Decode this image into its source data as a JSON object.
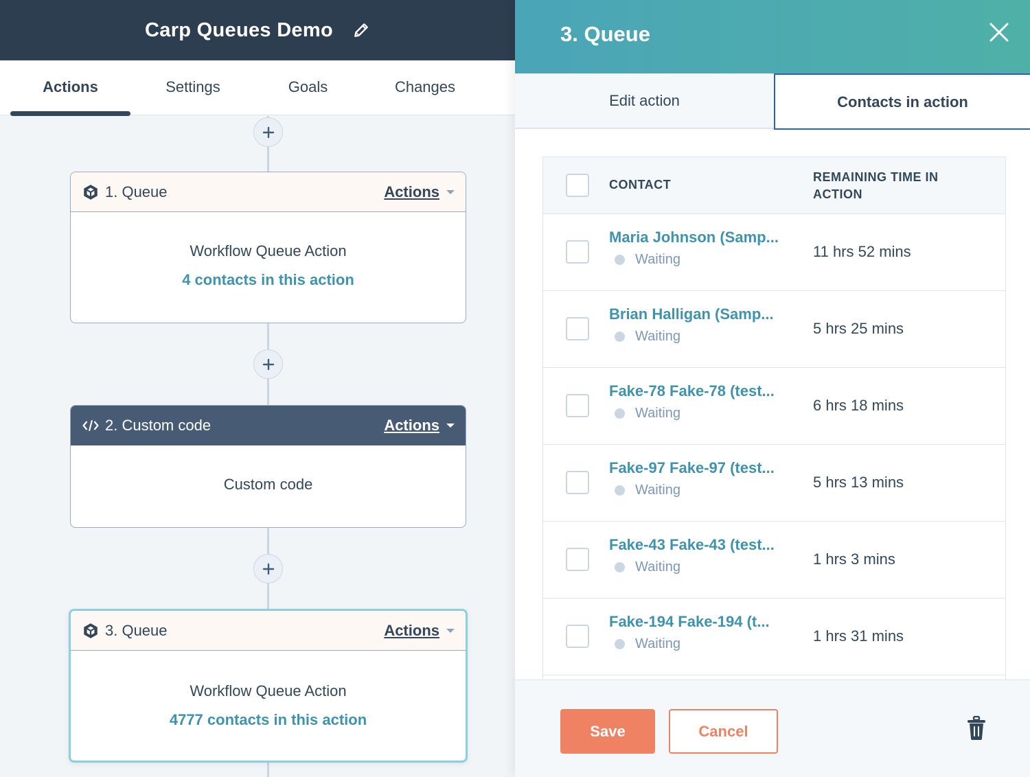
{
  "workflow": {
    "title": "Carp Queues Demo",
    "edit_icon": "pencil-icon",
    "tabs": [
      {
        "label": "Actions",
        "active": true
      },
      {
        "label": "Settings",
        "active": false
      },
      {
        "label": "Goals",
        "active": false
      },
      {
        "label": "Changes",
        "active": false
      }
    ],
    "add_icon": "plus-icon",
    "cards": [
      {
        "icon": "cube-icon",
        "name": "1. Queue",
        "actions_label": "Actions",
        "line1": "Workflow Queue Action",
        "line2": "4 contacts in this action"
      },
      {
        "icon": "code-icon",
        "name": "2. Custom code",
        "actions_label": "Actions",
        "line1": "Custom code"
      },
      {
        "icon": "cube-icon",
        "name": "3. Queue",
        "actions_label": "Actions",
        "line1": "Workflow Queue Action",
        "line2": "4777 contacts in this action",
        "selected": true
      }
    ]
  },
  "panel": {
    "title": "3. Queue",
    "close_icon": "close-icon",
    "tabs": [
      {
        "label": "Edit action",
        "active": false
      },
      {
        "label": "Contacts in action",
        "active": true
      }
    ],
    "table": {
      "columns": [
        "CONTACT",
        "REMAINING TIME IN ACTION"
      ],
      "rows": [
        {
          "name": "Maria Johnson (Samp...",
          "status": "Waiting",
          "time": "11 hrs 52 mins"
        },
        {
          "name": "Brian Halligan (Samp...",
          "status": "Waiting",
          "time": "5 hrs 25 mins"
        },
        {
          "name": "Fake-78 Fake-78 (test...",
          "status": "Waiting",
          "time": "6 hrs 18 mins"
        },
        {
          "name": "Fake-97 Fake-97 (test...",
          "status": "Waiting",
          "time": "5 hrs 13 mins"
        },
        {
          "name": "Fake-43 Fake-43 (test...",
          "status": "Waiting",
          "time": "1 hrs 3 mins"
        },
        {
          "name": "Fake-194 Fake-194 (t...",
          "status": "Waiting",
          "time": "1 hrs 31 mins"
        }
      ]
    },
    "footer": {
      "save_label": "Save",
      "cancel_label": "Cancel",
      "delete_icon": "trash-icon"
    }
  },
  "colors": {
    "header_dark": "#2d3e50",
    "link_teal": "#3e93ad",
    "accent_orange": "#ef8263",
    "tab_active_border": "#2b5fc5",
    "selected_card_border": "#8ccfe0"
  }
}
